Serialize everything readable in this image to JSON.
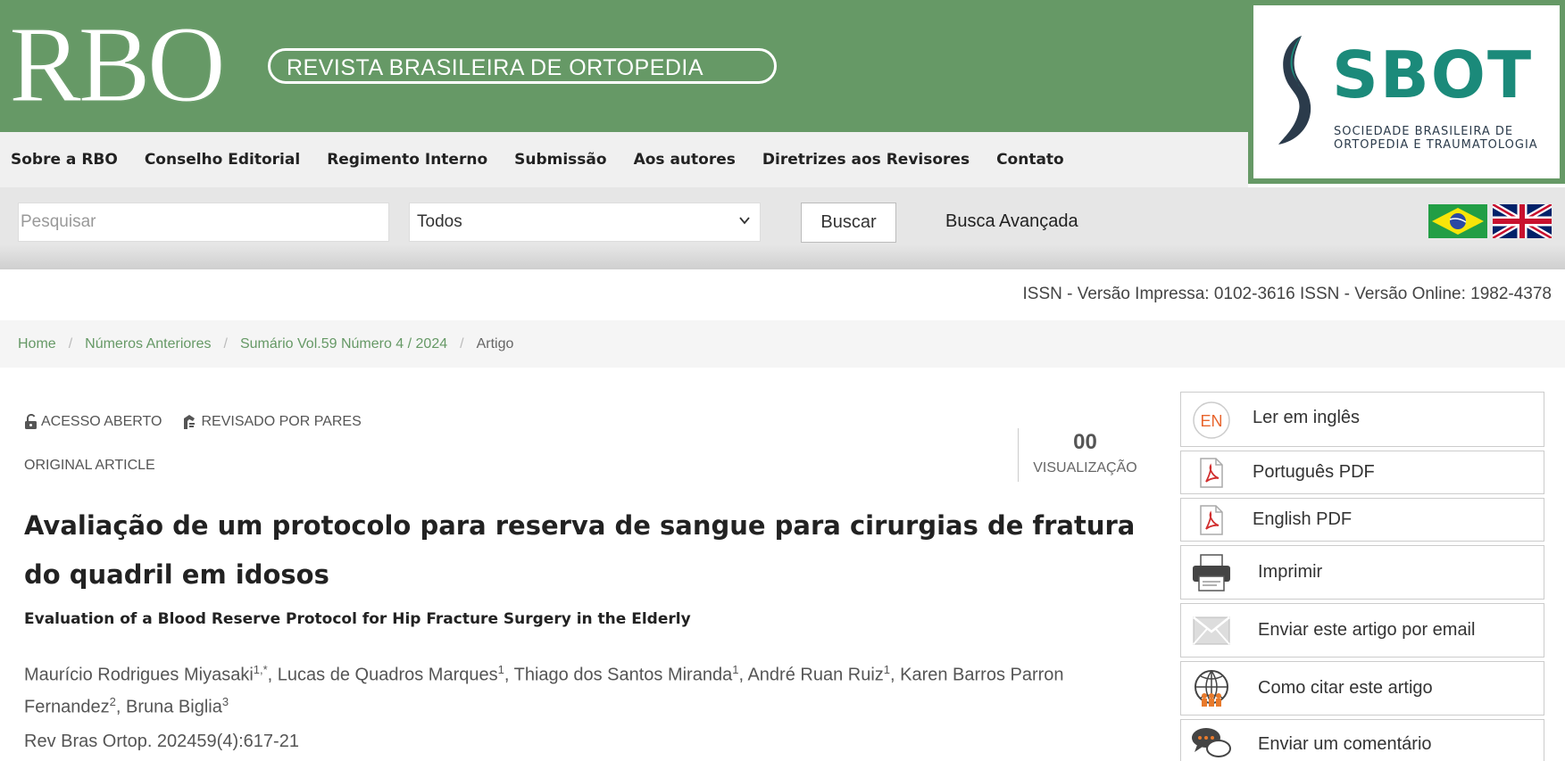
{
  "header": {
    "logo_letters": "RBO",
    "logo_subtitle": "REVISTA BRASILEIRA DE ORTOPEDIA",
    "partner_logo": {
      "title": "SBOT",
      "subtitle_line1": "SOCIEDADE BRASILEIRA DE",
      "subtitle_line2": "ORTOPEDIA E TRAUMATOLOGIA"
    },
    "brand_green": "#669966",
    "sbot_teal": "#1b8a7a"
  },
  "nav": {
    "items": [
      {
        "label": "Sobre a RBO"
      },
      {
        "label": "Conselho Editorial"
      },
      {
        "label": "Regimento Interno"
      },
      {
        "label": "Submissão"
      },
      {
        "label": "Aos autores"
      },
      {
        "label": "Diretrizes aos Revisores"
      },
      {
        "label": "Contato"
      }
    ]
  },
  "search": {
    "placeholder": "Pesquisar",
    "value": "",
    "scope_selected": "Todos",
    "button_label": "Buscar",
    "advanced_label": "Busca Avançada",
    "languages": [
      {
        "icon": "brazil-flag-icon"
      },
      {
        "icon": "uk-flag-icon"
      }
    ]
  },
  "issn": {
    "text": "ISSN - Versão Impressa: 0102-3616 ISSN - Versão Online: 1982-4378"
  },
  "breadcrumb": {
    "items": [
      {
        "label": "Home"
      },
      {
        "label": "Números Anteriores"
      },
      {
        "label": "Sumário Vol.59 Número 4 / 2024"
      }
    ],
    "current": "Artigo"
  },
  "article": {
    "badges": [
      {
        "label": "ACESSO ABERTO",
        "icon": "open-lock-icon"
      },
      {
        "label": "REVISADO POR PARES",
        "icon": "reviewer-icon"
      }
    ],
    "type": "ORIGINAL ARTICLE",
    "views": {
      "count": "00",
      "label": "VISUALIZAÇÃO"
    },
    "title": "Avaliação de um protocolo para reserva de sangue para cirurgias de fratura do quadril em idosos",
    "subtitle": "Evaluation of a Blood Reserve Protocol for Hip Fracture Surgery in the Elderly",
    "authors": [
      {
        "name": "Maurício Rodrigues Miyasaki",
        "sup": "1,*",
        "sep": ", "
      },
      {
        "name": "Lucas de Quadros Marques",
        "sup": "1",
        "sep": ", "
      },
      {
        "name": "Thiago dos Santos Miranda",
        "sup": "1",
        "sep": ", "
      },
      {
        "name": "André Ruan Ruiz",
        "sup": "1",
        "sep": ", "
      },
      {
        "name": "Karen Barros Parron Fernandez",
        "sup": "2",
        "sep": ", "
      },
      {
        "name": "Bruna Biglia",
        "sup": "3",
        "sep": ""
      }
    ],
    "citation": "Rev Bras Ortop. 202459(4):617-21"
  },
  "sidebar": {
    "items": [
      {
        "label": "Ler em inglês",
        "icon": "en-language-icon",
        "icon_text": "EN"
      },
      {
        "label": "Português PDF",
        "icon": "pdf-icon"
      },
      {
        "label": "English PDF",
        "icon": "pdf-icon"
      },
      {
        "label": "Imprimir",
        "icon": "printer-icon"
      },
      {
        "label": "Enviar este artigo por email",
        "icon": "envelope-icon"
      },
      {
        "label": "Como citar este artigo",
        "icon": "globe-people-icon"
      },
      {
        "label": "Enviar um comentário",
        "icon": "comment-icon"
      }
    ]
  }
}
